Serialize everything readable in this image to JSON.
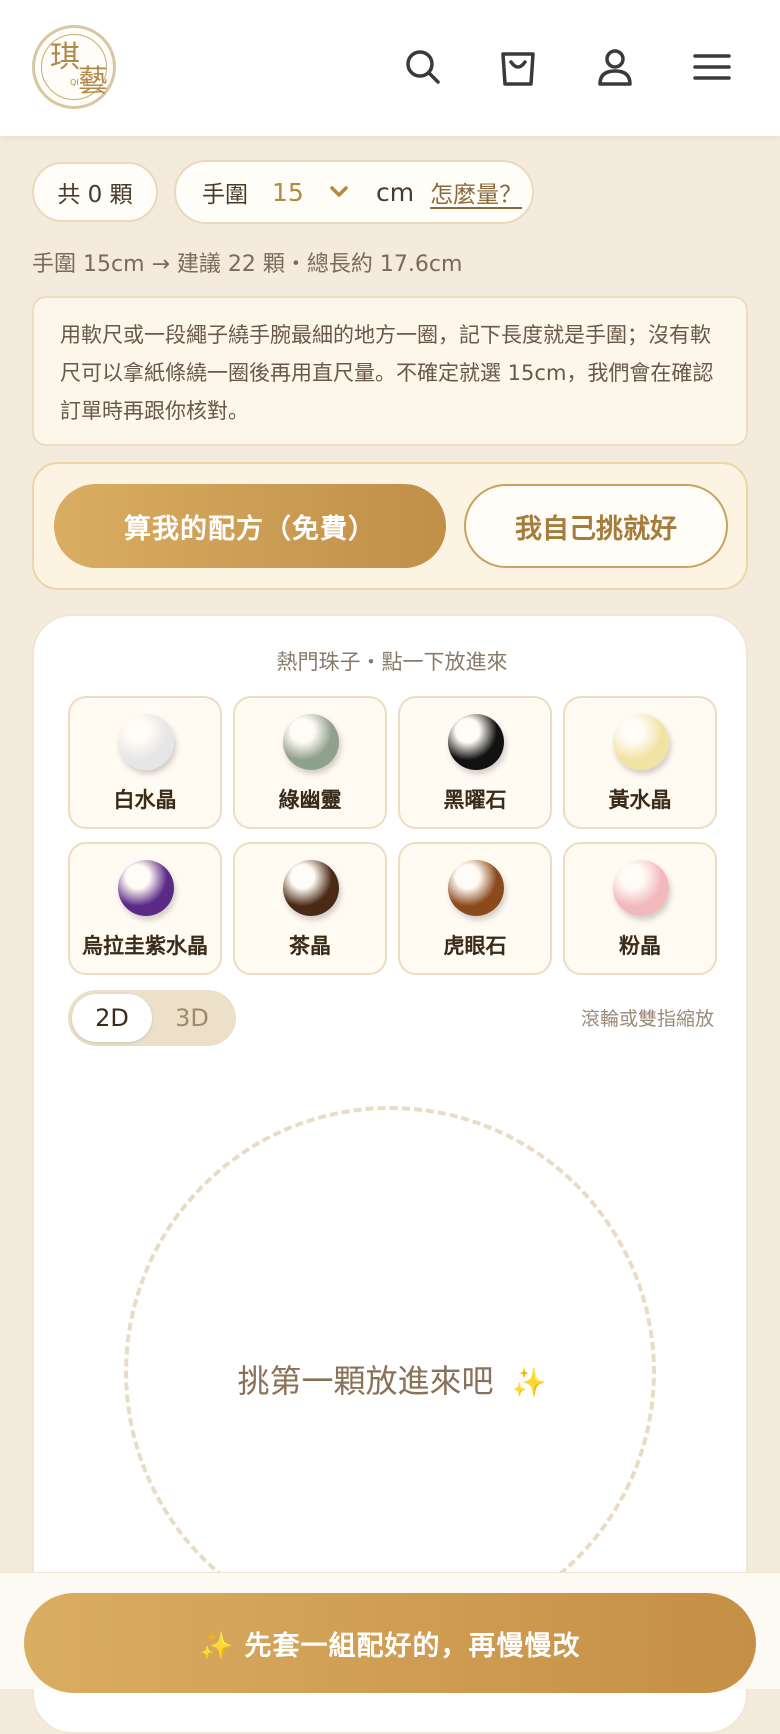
{
  "header": {
    "logo_main_1": "琪",
    "logo_main_2": "藝",
    "logo_sub": "QI YI",
    "icons": [
      "search-icon",
      "cart-icon",
      "user-icon",
      "menu-icon"
    ]
  },
  "controls": {
    "count_text": "共 0 顆",
    "size_label": "手圍",
    "size_value": "15",
    "size_unit": "cm",
    "how_link": "怎麼量？"
  },
  "suggestion": "手圍 15cm → 建議 22 顆・總長約 17.6cm",
  "tip": "用軟尺或一段繩子繞手腕最細的地方一圈，記下長度就是手圍；沒有軟尺可以拿紙條繞一圈後再用直尺量。不確定就選 15cm，我們會在確認訂單時再跟你核對。",
  "cta": {
    "primary": "算我的配方（免費）",
    "secondary": "我自己挑就好"
  },
  "beads": {
    "title": "熱門珠子・點一下放進來",
    "items": [
      {
        "name": "白水晶",
        "color": "#e6e6e6"
      },
      {
        "name": "綠幽靈",
        "color": "#8fa08c"
      },
      {
        "name": "黑曜石",
        "color": "#111111"
      },
      {
        "name": "黃水晶",
        "color": "#f1e3a4"
      },
      {
        "name": "烏拉圭紫水晶",
        "color": "#5b2a86"
      },
      {
        "name": "茶晶",
        "color": "#4a2a16"
      },
      {
        "name": "虎眼石",
        "color": "#8a4a1c"
      },
      {
        "name": "粉晶",
        "color": "#f2b9bd"
      }
    ]
  },
  "view": {
    "mode_2d": "2D",
    "mode_3d": "3D",
    "zoom_hint": "滾輪或雙指縮放"
  },
  "stage": {
    "empty_text": "挑第一顆放進來吧",
    "sparkle": "✨"
  },
  "bottom": {
    "label": "✨ 先套一組配好的，再慢慢改"
  }
}
